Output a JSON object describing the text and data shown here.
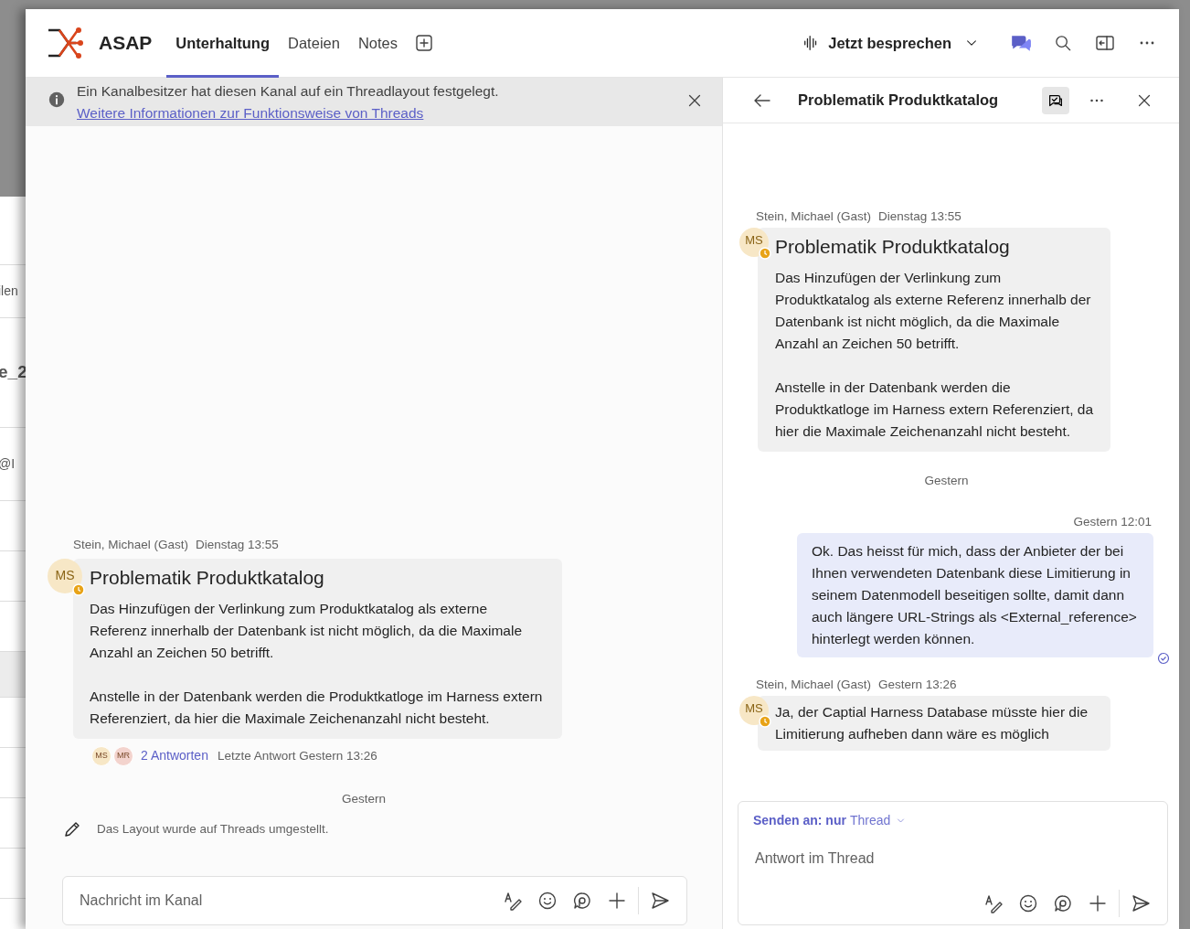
{
  "background_window": {
    "fragments": [
      "ilen",
      "e_2",
      "@I"
    ]
  },
  "header": {
    "app_name": "ASAP",
    "tabs": [
      {
        "label": "Unterhaltung",
        "selected": true
      },
      {
        "label": "Dateien",
        "selected": false
      },
      {
        "label": "Notes",
        "selected": false
      }
    ],
    "meet_button": {
      "label": "Jetzt besprechen"
    }
  },
  "banner": {
    "text": "Ein Kanalbesitzer hat diesen Kanal auf ein Threadlayout festgelegt.",
    "link": "Weitere Informationen zur Funktionsweise von Threads"
  },
  "channel": {
    "post": {
      "author": "Stein, Michael (Gast)",
      "time": "Dienstag 13:55",
      "avatar": {
        "initials": "MS",
        "color": "#f7e7c6"
      },
      "title": "Problematik Produktkatalog",
      "paragraphs": [
        "Das Hinzufügen der Verlinkung zum Produktkatalog als externe Referenz innerhalb der Datenbank ist nicht möglich, da die Maximale Anzahl an Zeichen 50 betrifft.",
        "Anstelle in der Datenbank werden die Produktkatloge im Harness extern Referenziert, da hier die Maximale Zeichenanzahl nicht besteht."
      ],
      "reply_avatars": [
        {
          "initials": "MS",
          "color": "#f7e7c6"
        },
        {
          "initials": "MR",
          "color": "#f3d3cd"
        }
      ],
      "reply_count": "2 Antworten",
      "last_reply": "Letzte Antwort Gestern 13:26"
    },
    "date_divider": "Gestern",
    "system_message": "Das Layout wurde auf Threads umgestellt.",
    "composer": {
      "placeholder": "Nachricht im Kanal"
    }
  },
  "thread": {
    "title": "Problematik Produktkatalog",
    "items": [
      {
        "kind": "post",
        "author": "Stein, Michael (Gast)",
        "time": "Dienstag 13:55",
        "avatar": {
          "initials": "MS",
          "color": "#f7e7c6"
        },
        "title": "Problematik Produktkatalog",
        "paragraphs": [
          "Das Hinzufügen der Verlinkung zum Produktkatalog als externe Referenz innerhalb der Datenbank ist nicht möglich, da die Maximale Anzahl an Zeichen 50 betrifft.",
          "Anstelle in der Datenbank werden die Produktkatloge im Harness extern Referenziert, da hier die Maximale Zeichenanzahl nicht besteht."
        ]
      },
      {
        "kind": "divider",
        "text": "Gestern"
      },
      {
        "kind": "own",
        "time": "Gestern 12:01",
        "paragraphs": [
          "Ok. Das heisst für mich, dass der Anbieter der bei Ihnen verwendeten Datenbank diese Limitierung in seinem Datenmodell beseitigen sollte, damit dann auch längere URL-Strings als <External_reference> hinterlegt werden können."
        ]
      },
      {
        "kind": "reply",
        "author": "Stein, Michael (Gast)",
        "time": "Gestern 13:26",
        "avatar": {
          "initials": "MS",
          "color": "#f7e7c6"
        },
        "paragraphs": [
          "Ja, der Captial Harness Database müsste hier die Limitierung aufheben dann wäre es möglich"
        ]
      }
    ],
    "composer": {
      "send_to_label": "Senden an: nur",
      "send_to_value": "Thread",
      "placeholder": "Antwort im Thread"
    }
  }
}
